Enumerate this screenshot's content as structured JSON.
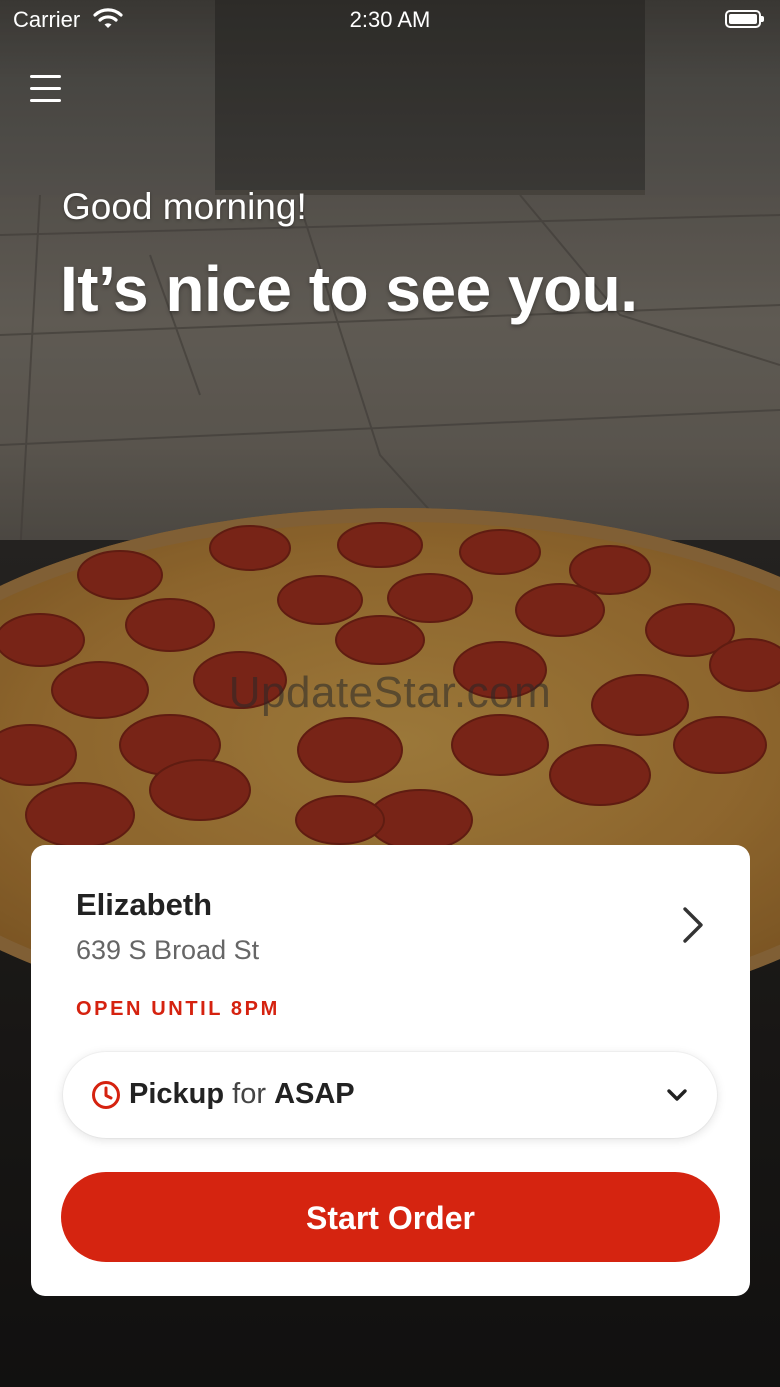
{
  "status_bar": {
    "carrier": "Carrier",
    "time": "2:30 AM"
  },
  "greeting": {
    "salutation": "Good morning!",
    "headline": "It’s nice to see you."
  },
  "watermark": "UpdateStar.com",
  "store": {
    "name": "Elizabeth",
    "address": "639 S Broad St",
    "hours_status": "OPEN UNTIL 8PM"
  },
  "order_mode": {
    "mode": "Pickup",
    "connector": "for",
    "time": "ASAP"
  },
  "actions": {
    "start_order": "Start Order"
  },
  "colors": {
    "accent": "#d52410",
    "status_red": "#d5220f",
    "card_bg": "#ffffff"
  },
  "icons": [
    "wifi-icon",
    "battery-icon",
    "menu-icon",
    "chevron-right-icon",
    "clock-icon",
    "chevron-down-icon"
  ]
}
